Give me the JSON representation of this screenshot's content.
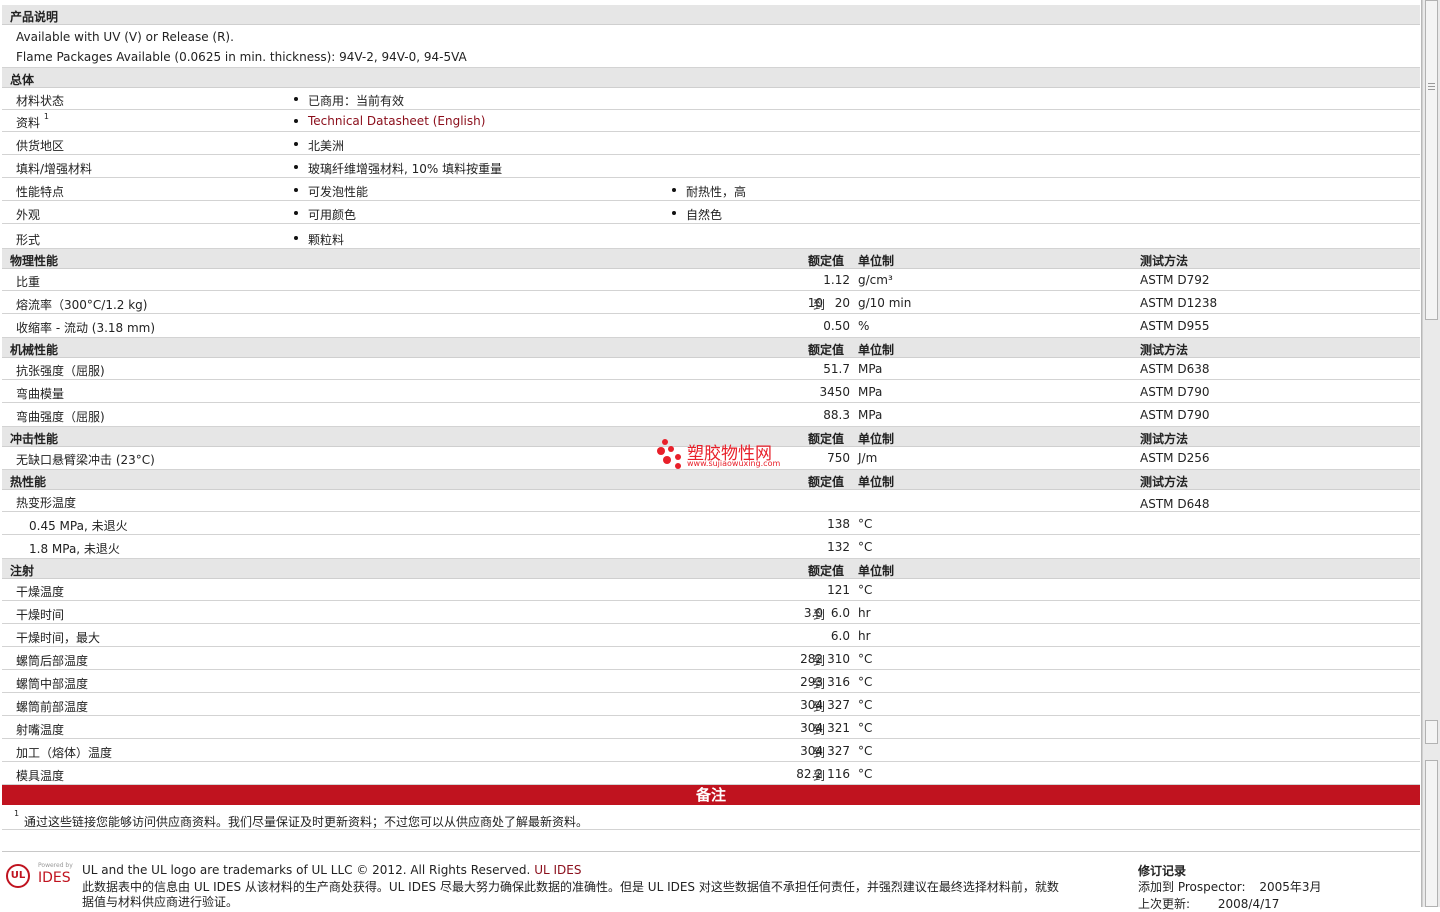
{
  "sections": {
    "desc": {
      "title": "产品说明",
      "lines": [
        "Available with UV (V) or Release (R).",
        "Flame Packages Available (0.0625 in min. thickness): 94V-2, 94V-0, 94-5VA"
      ]
    },
    "general": {
      "title": "总体",
      "rows": [
        {
          "label": "材料状态",
          "b1": "已商用：当前有效"
        },
        {
          "label": "资料",
          "sup": "1",
          "b1": "Technical Datasheet (English)"
        },
        {
          "label": "供货地区",
          "b1": "北美洲"
        },
        {
          "label": "填料/增强材料",
          "b1": "玻璃纤维增强材料, 10% 填料按重量"
        },
        {
          "label": "性能特点",
          "b1": "可发泡性能",
          "b2": "耐热性，高"
        },
        {
          "label": "外观",
          "b1": "可用颜色",
          "b2": "自然色"
        },
        {
          "label": "形式",
          "b1": "颗粒料"
        }
      ]
    },
    "col_headers": {
      "nominal": "额定值",
      "unit": "单位制",
      "test": "测试方法"
    },
    "physical": {
      "title": "物理性能",
      "rows": [
        {
          "label": "比重",
          "val": "1.12",
          "unit": "g/cm³",
          "test": "ASTM D792"
        },
        {
          "label": "熔流率（300°C/1.2 kg)",
          "lo": "10",
          "to": "到",
          "val": "20",
          "unit": "g/10 min",
          "test": "ASTM D1238"
        },
        {
          "label": "收缩率 - 流动 (3.18 mm)",
          "val": "0.50",
          "unit": "%",
          "test": "ASTM D955"
        }
      ]
    },
    "mechanical": {
      "title": "机械性能",
      "rows": [
        {
          "label": "抗张强度（屈服)",
          "val": "51.7",
          "unit": "MPa",
          "test": "ASTM D638"
        },
        {
          "label": "弯曲模量",
          "val": "3450",
          "unit": "MPa",
          "test": "ASTM D790"
        },
        {
          "label": "弯曲强度（屈服)",
          "val": "88.3",
          "unit": "MPa",
          "test": "ASTM D790"
        }
      ]
    },
    "impact": {
      "title": "冲击性能",
      "rows": [
        {
          "label": "无缺口悬臂梁冲击 (23°C)",
          "val": "750",
          "unit": "J/m",
          "test": "ASTM D256"
        }
      ]
    },
    "thermal": {
      "title": "热性能",
      "rows": [
        {
          "label": "热变形温度",
          "test": "ASTM D648"
        },
        {
          "label": "0.45 MPa, 未退火",
          "indent": true,
          "val": "138",
          "unit": "°C"
        },
        {
          "label": "1.8 MPa, 未退火",
          "indent": true,
          "val": "132",
          "unit": "°C"
        }
      ]
    },
    "injection": {
      "title": "注射",
      "rows": [
        {
          "label": "干燥温度",
          "val": "121",
          "unit": "°C"
        },
        {
          "label": "干燥时间",
          "lo": "3.0",
          "to": "到",
          "val": "6.0",
          "unit": "hr"
        },
        {
          "label": "干燥时间，最大",
          "val": "6.0",
          "unit": "hr"
        },
        {
          "label": "螺筒后部温度",
          "lo": "282",
          "to": "到",
          "val": "310",
          "unit": "°C"
        },
        {
          "label": "螺筒中部温度",
          "lo": "293",
          "to": "到",
          "val": "316",
          "unit": "°C"
        },
        {
          "label": "螺筒前部温度",
          "lo": "304",
          "to": "到",
          "val": "327",
          "unit": "°C"
        },
        {
          "label": "射嘴温度",
          "lo": "304",
          "to": "到",
          "val": "321",
          "unit": "°C"
        },
        {
          "label": "加工（熔体）温度",
          "lo": "304",
          "to": "到",
          "val": "327",
          "unit": "°C"
        },
        {
          "label": "模具温度",
          "lo": "82.2",
          "to": "到",
          "val": "116",
          "unit": "°C"
        }
      ]
    }
  },
  "notes": {
    "title": "备注",
    "sup": "1",
    "text": "通过这些链接您能够访问供应商资料。我们尽量保证及时更新资料；不过您可以从供应商处了解最新资料。"
  },
  "footer": {
    "powered": "Powered by",
    "ides": "IDES",
    "ul": "UL",
    "trademark": "UL and the UL logo are trademarks of UL LLC © 2012. All Rights Reserved.",
    "trademark_link": "UL IDES",
    "disclaimer1": "此数据表中的信息由 UL IDES 从该材料的生产商处获得。UL IDES 尽最大努力确保此数据的准确性。但是 UL IDES 对这些数据值不承担任何责任，并强烈建议在最终选择材料前，就数",
    "disclaimer2": "据值与材料供应商进行验证。",
    "rev_title": "修订记录",
    "added_label": "添加到 Prospector:",
    "added_value": "2005年3月",
    "updated_label": "上次更新:",
    "updated_value": "2008/4/17"
  },
  "watermark": {
    "cn": "塑胶物性网",
    "url": "www.sujiaowuxing.com",
    "color": "#e8202a"
  }
}
